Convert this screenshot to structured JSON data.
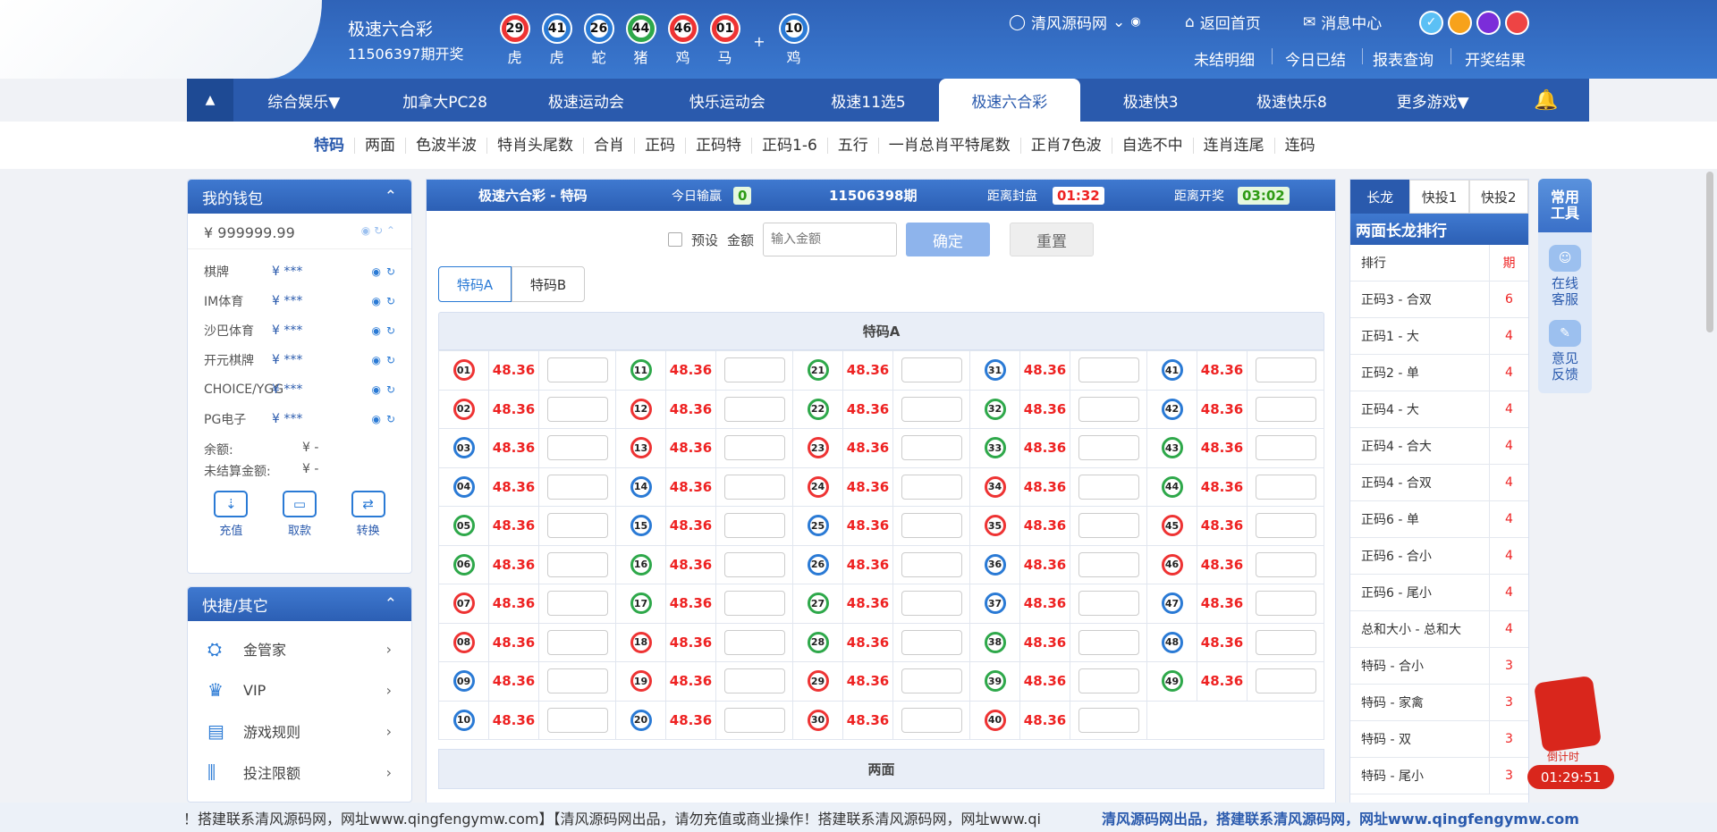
{
  "header": {
    "lottery_name": "极速六合彩",
    "period_label": "11506397期开奖",
    "balls": [
      {
        "num": "29",
        "zodiac": "虎",
        "color": "#e33"
      },
      {
        "num": "41",
        "zodiac": "虎",
        "color": "#2a7ad5"
      },
      {
        "num": "26",
        "zodiac": "蛇",
        "color": "#2a7ad5"
      },
      {
        "num": "44",
        "zodiac": "猪",
        "color": "#2ea84a"
      },
      {
        "num": "46",
        "zodiac": "鸡",
        "color": "#e33"
      },
      {
        "num": "01",
        "zodiac": "马",
        "color": "#e33"
      }
    ],
    "plus": "+",
    "special_ball": {
      "num": "10",
      "zodiac": "鸡",
      "color": "#2a7ad5"
    },
    "user": "清风源码网",
    "home": "返回首页",
    "messages": "消息中心",
    "links": [
      "未结明细",
      "今日已结",
      "报表查询",
      "开奖结果"
    ],
    "theme_colors": [
      "#5bc0f5",
      "#f7a21b",
      "#7b2dd9",
      "#e44"
    ]
  },
  "nav": {
    "items": [
      "综合娱乐▼",
      "加拿大PC28",
      "极速运动会",
      "快乐运动会",
      "极速11选5",
      "极速六合彩",
      "极速快3",
      "极速快乐8",
      "更多游戏▼"
    ],
    "active": "极速六合彩",
    "toggle_icon": "▲",
    "bell_icon": "🔔"
  },
  "subnav": [
    "特码",
    "两面",
    "色波半波",
    "特肖头尾数",
    "合肖",
    "正码",
    "正码特",
    "正码1-6",
    "五行",
    "一肖总肖平特尾数",
    "正肖7色波",
    "自选不中",
    "连肖连尾",
    "连码"
  ],
  "wallet": {
    "title": "我的钱包",
    "total": "¥ 999999.99",
    "rows": [
      {
        "name": "棋牌",
        "value": "¥ ***"
      },
      {
        "name": "IM体育",
        "value": "¥ ***"
      },
      {
        "name": "沙巴体育",
        "value": "¥ ***"
      },
      {
        "name": "开元棋牌",
        "value": "¥ ***"
      },
      {
        "name": "CHOICE/YGG",
        "value": "¥ ***"
      },
      {
        "name": "PG电子",
        "value": "¥ ***"
      }
    ],
    "balance_label": "余额:",
    "balance_value": "¥ -",
    "unsettled_label": "未结算金额:",
    "unsettled_value": "¥ -",
    "buttons": [
      "充值",
      "取款",
      "转换"
    ]
  },
  "quick": {
    "title": "快捷/其它",
    "items": [
      "金管家",
      "VIP",
      "游戏规则",
      "投注限额"
    ]
  },
  "main": {
    "title": "极速六合彩 - 特码",
    "today_label": "今日输赢",
    "today_value": "0",
    "period": "11506398期",
    "close_label": "距离封盘",
    "close_value": "01:32",
    "open_label": "距离开奖",
    "open_value": "03:02",
    "preset": "预设",
    "amount_label": "金额",
    "amount_placeholder": "输入金额",
    "confirm": "确定",
    "reset": "重置",
    "tabs": [
      "特码A",
      "特码B"
    ],
    "section_a": "特码A",
    "section_b": "两面",
    "odds": "48.36"
  },
  "rank": {
    "tabs": [
      "长龙",
      "快投1",
      "快投2"
    ],
    "title": "两面长龙排行",
    "col1": "排行",
    "col2": "期",
    "rows": [
      {
        "name": "正码3 - 合双",
        "count": "6"
      },
      {
        "name": "正码1 - 大",
        "count": "4"
      },
      {
        "name": "正码2 - 单",
        "count": "4"
      },
      {
        "name": "正码4 - 大",
        "count": "4"
      },
      {
        "name": "正码4 - 合大",
        "count": "4"
      },
      {
        "name": "正码4 - 合双",
        "count": "4"
      },
      {
        "name": "正码6 - 单",
        "count": "4"
      },
      {
        "name": "正码6 - 合小",
        "count": "4"
      },
      {
        "name": "正码6 - 尾小",
        "count": "4"
      },
      {
        "name": "总和大小 - 总和大",
        "count": "4"
      },
      {
        "name": "特码 - 合小",
        "count": "3"
      },
      {
        "name": "特码 - 家禽",
        "count": "3"
      },
      {
        "name": "特码 - 双",
        "count": "3"
      },
      {
        "name": "特码 - 尾小",
        "count": "3"
      }
    ]
  },
  "tools": {
    "title_line1": "常用",
    "title_line2": "工具",
    "items": [
      [
        "在线",
        "客服"
      ],
      [
        "意见",
        "反馈"
      ]
    ]
  },
  "redpack": {
    "label": "倒计时",
    "time": "01:29:51"
  },
  "ticker": {
    "text1": "！搭建联系清风源码网，网址www.qingfengymw.com】【清风源码网出品，请勿充值或商业操作！搭建联系清风源码网，网址www.qi",
    "text2": "清风源码网出品，搭建联系清风源码网，网址www.qingfengymw.com"
  }
}
